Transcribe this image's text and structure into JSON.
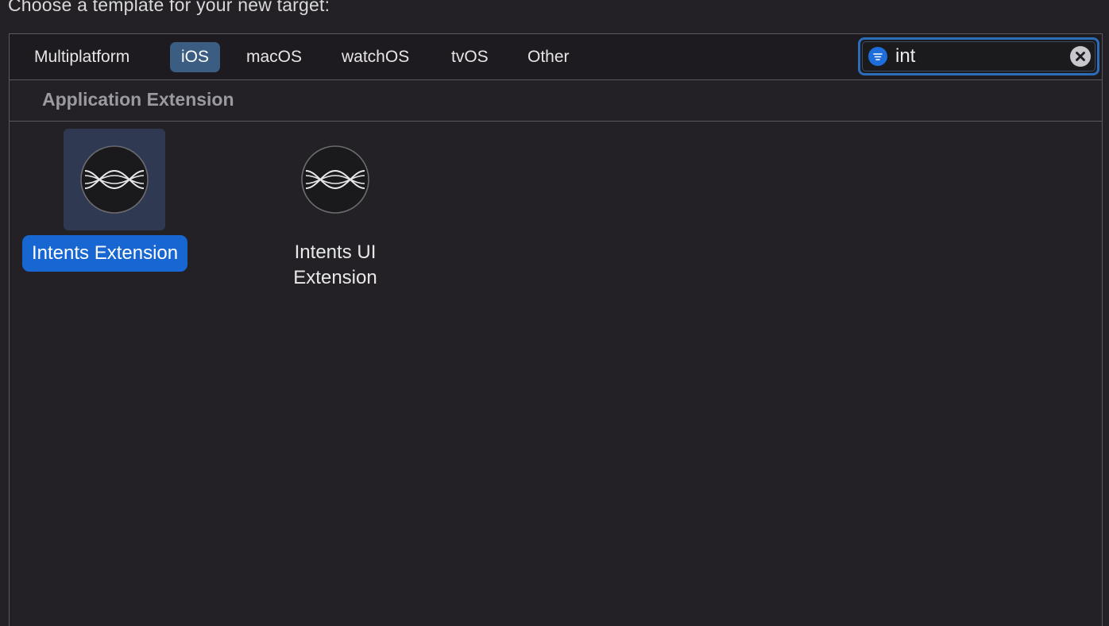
{
  "dialog": {
    "title": "Choose a template for your new target:"
  },
  "tabs": [
    {
      "label": "Multiplatform",
      "selected": false
    },
    {
      "label": "iOS",
      "selected": true
    },
    {
      "label": "macOS",
      "selected": false
    },
    {
      "label": "watchOS",
      "selected": false
    },
    {
      "label": "tvOS",
      "selected": false
    },
    {
      "label": "Other",
      "selected": false
    }
  ],
  "search": {
    "value": "int",
    "filter_icon": "filter-icon",
    "clear_icon": "clear-icon"
  },
  "section": {
    "label": "Application Extension"
  },
  "templates": [
    {
      "label": "Intents Extension",
      "selected": true,
      "icon": "intents-icon"
    },
    {
      "label_line1": "Intents UI",
      "label_line2": "Extension",
      "selected": false,
      "icon": "intents-ui-icon"
    }
  ],
  "colors": {
    "background": "#232125",
    "accent": "#1766d1",
    "selected_tab": "#3b5d82",
    "search_focus": "#2c6cb8"
  }
}
